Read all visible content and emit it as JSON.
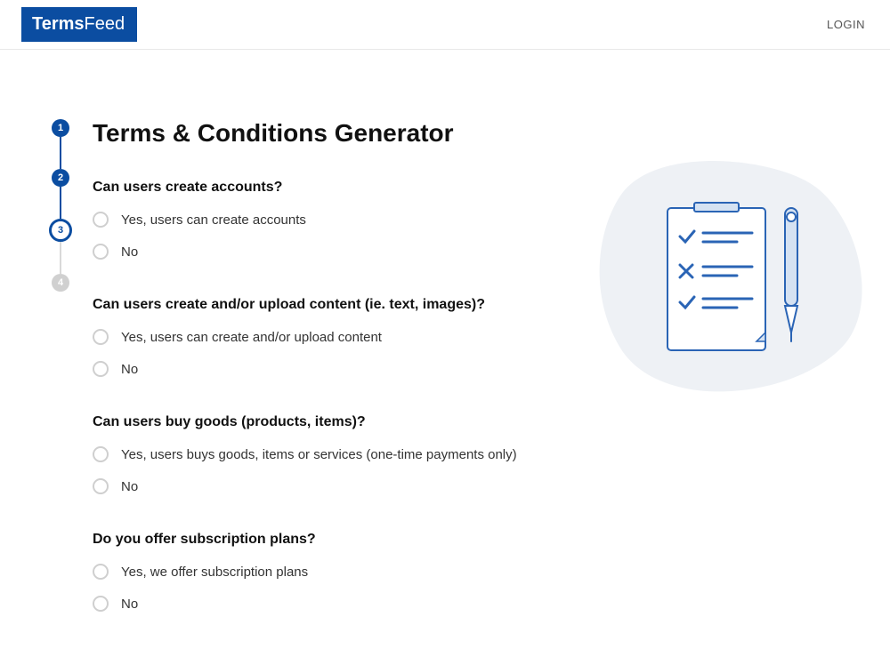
{
  "header": {
    "logo_prefix": "Terms",
    "logo_suffix": "Feed",
    "login": "LOGIN"
  },
  "stepper": {
    "steps": [
      "1",
      "2",
      "3",
      "4"
    ],
    "current_index": 2
  },
  "page_title": "Terms & Conditions Generator",
  "questions": [
    {
      "title": "Can users create accounts?",
      "options": [
        "Yes, users can create accounts",
        "No"
      ]
    },
    {
      "title": "Can users create and/or upload content (ie. text, images)?",
      "options": [
        "Yes, users can create and/or upload content",
        "No"
      ]
    },
    {
      "title": "Can users buy goods (products, items)?",
      "options": [
        "Yes, users buys goods, items or services (one-time payments only)",
        "No"
      ]
    },
    {
      "title": "Do you offer subscription plans?",
      "options": [
        "Yes, we offer subscription plans",
        "No"
      ]
    }
  ]
}
